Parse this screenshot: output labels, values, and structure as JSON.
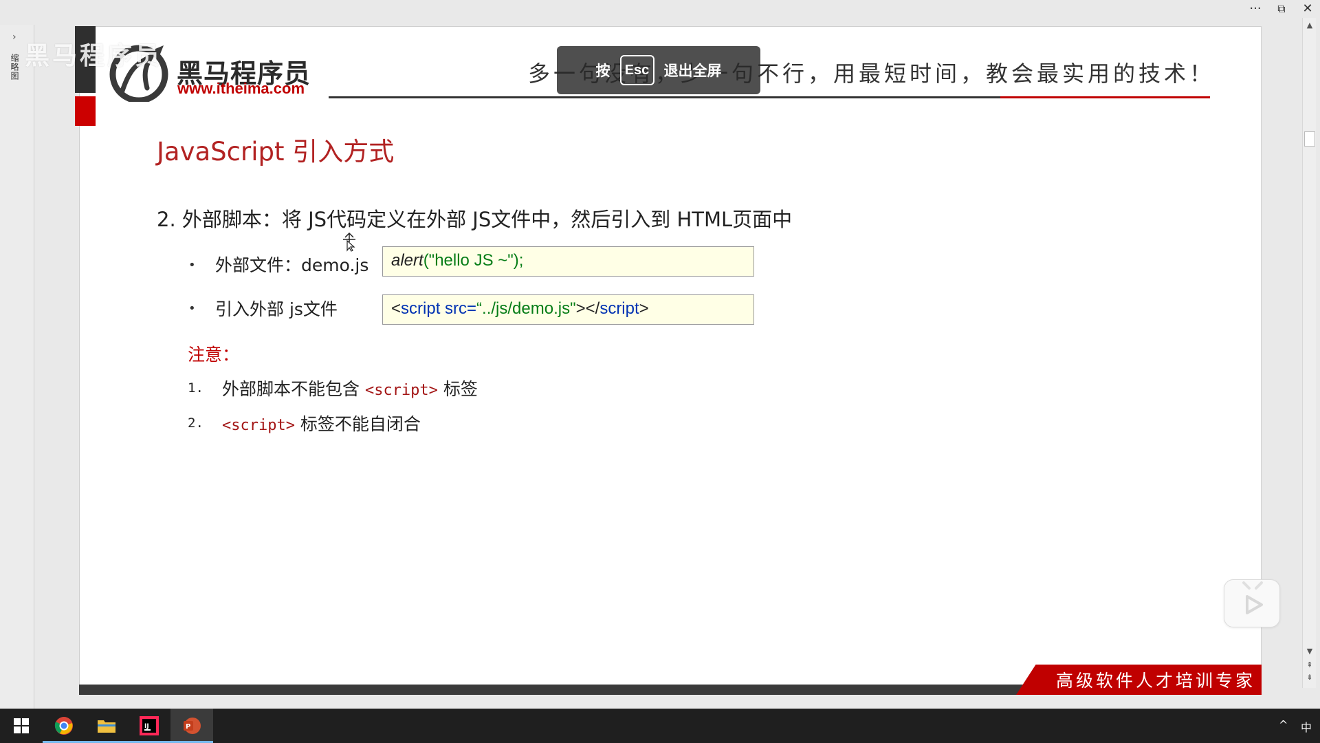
{
  "window": {
    "more_icon": "more-icon",
    "restore_icon": "restore-icon",
    "close_icon": "close-icon",
    "more_glyph": "···",
    "restore_glyph": "⧉",
    "close_glyph": "✕"
  },
  "left_panel": {
    "expand_glyph": "›",
    "label": "缩略图"
  },
  "slide": {
    "watermark": "黑马程序员",
    "logo_main": "黑马程序员",
    "logo_url": "www.itheima.com",
    "slogan": "多一句没有，少一句不行，用最短时间，教会最实用的技术！",
    "esc_overlay": {
      "press": "按",
      "key": "Esc",
      "action": "退出全屏"
    },
    "title": "JavaScript 引入方式",
    "point": "2.  外部脚本：将 JS代码定义在外部 JS文件中，然后引入到 HTML页面中",
    "items": [
      {
        "bullet": "•",
        "label": "外部文件：demo.js",
        "code": {
          "fn": "alert",
          "args": "(\"hello JS ~\");"
        }
      },
      {
        "bullet": "•",
        "label": "引入外部 js文件",
        "code": {
          "open_lt": "<",
          "tag": "script",
          "attr": " src=",
          "value": "“../js/demo.js\"",
          "mid": "></",
          "close_tag": "script",
          "close_gt": ">"
        }
      }
    ],
    "note_title": "注意：",
    "notes": [
      {
        "num": "1.",
        "pre": "外部脚本不能包含 ",
        "code": "<script>",
        "post": " 标签"
      },
      {
        "num": "2.",
        "pre": "",
        "code": "<script>",
        "post": " 标签不能自闭合"
      }
    ],
    "banner": "高级软件人才培训专家"
  },
  "taskbar": {
    "apps": [
      "windows-start",
      "chrome",
      "file-explorer",
      "intellij-idea",
      "powerpoint"
    ],
    "tray_chevron": "^",
    "ime": "中"
  },
  "colors": {
    "title_red": "#b22222",
    "accent_red": "#c00000",
    "code_bg": "#ffffe6",
    "keyword_blue": "#0033b3",
    "string_green": "#067d17"
  }
}
